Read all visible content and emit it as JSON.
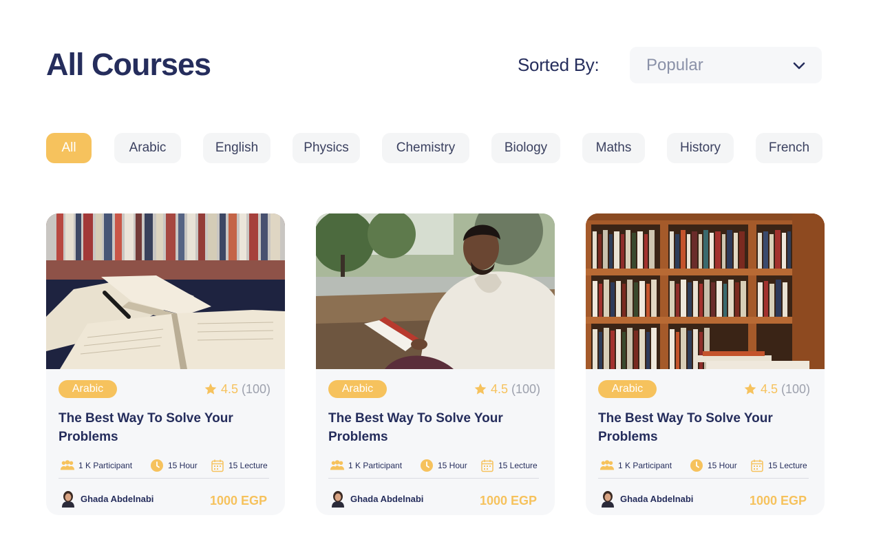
{
  "header": {
    "title": "All Courses",
    "sort_label": "Sorted By:",
    "sort_value": "Popular"
  },
  "filters": [
    "All",
    "Arabic",
    "English",
    "Physics",
    "Chemistry",
    "Biology",
    "Maths",
    "History",
    "French"
  ],
  "active_filter": "All",
  "courses": [
    {
      "image": "open-books-on-table",
      "category": "Arabic",
      "rating": "4.5",
      "rating_count": "(100)",
      "title": "The Best Way To Solve Your Problems",
      "participants": "1 K Participant",
      "hours": "15 Hour",
      "lectures": "15 Lecture",
      "author": "Ghada Abdelnabi",
      "price": "1000 EGP"
    },
    {
      "image": "man-reading-book-outdoors",
      "category": "Arabic",
      "rating": "4.5",
      "rating_count": "(100)",
      "title": "The Best Way To Solve Your Problems",
      "participants": "1 K Participant",
      "hours": "15 Hour",
      "lectures": "15 Lecture",
      "author": "Ghada Abdelnabi",
      "price": "1000 EGP"
    },
    {
      "image": "library-bookshelf",
      "category": "Arabic",
      "rating": "4.5",
      "rating_count": "(100)",
      "title": "The Best Way To Solve Your Problems",
      "participants": "1 K Participant",
      "hours": "15 Hour",
      "lectures": "15 Lecture",
      "author": "Ghada Abdelnabi",
      "price": "1000 EGP"
    }
  ],
  "colors": {
    "primary": "#252d5c",
    "accent": "#f6c25d",
    "chip_bg": "#f4f5f6",
    "card_bg": "#f6f7f9",
    "muted": "#9da1ad"
  }
}
